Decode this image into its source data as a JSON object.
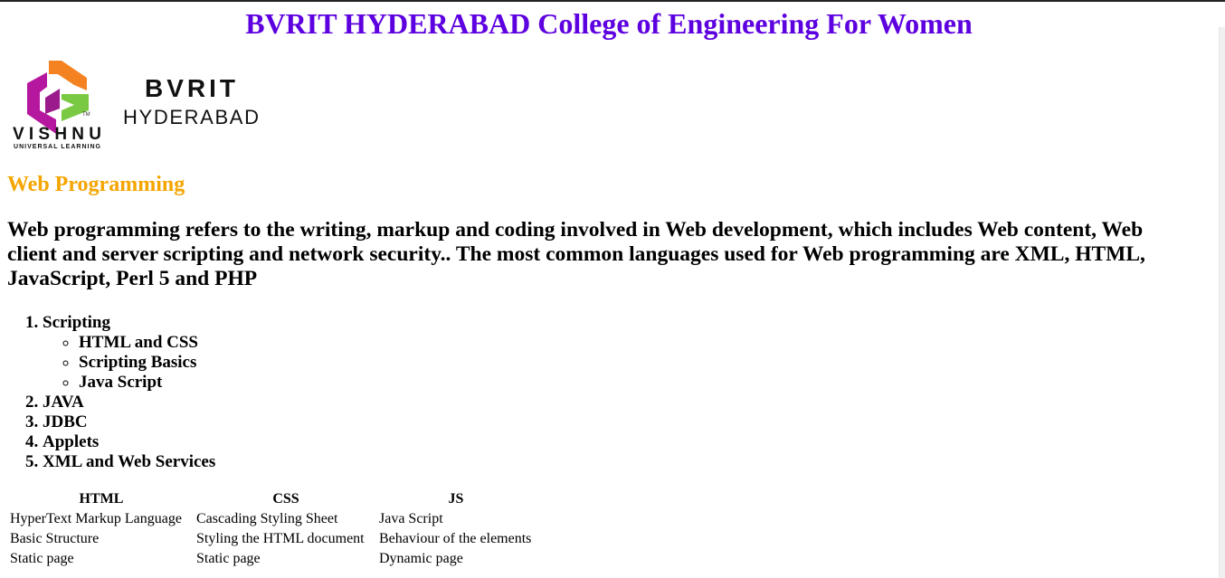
{
  "header": {
    "title": "BVRIT HYDERABAD College of Engineering For Women"
  },
  "logo": {
    "brand_word": "VISHNU",
    "brand_tag": "UNIVERSAL LEARNING",
    "tm": "TM",
    "college_name": "BVRIT",
    "college_city": "HYDERABAD",
    "colors": {
      "orange": "#f58220",
      "magenta": "#b5179e",
      "green": "#7ac943"
    }
  },
  "subject": {
    "title": "Web Programming",
    "color": "#f5a500"
  },
  "description": "Web programming refers to the writing, markup and coding involved in Web development, which includes Web content, Web client and server scripting and network security.. The most common languages used for Web programming are XML, HTML, JavaScript, Perl 5 and PHP",
  "topics": [
    {
      "label": "Scripting",
      "children": [
        "HTML and CSS",
        "Scripting Basics",
        "Java Script"
      ]
    },
    {
      "label": "JAVA"
    },
    {
      "label": "JDBC"
    },
    {
      "label": "Applets"
    },
    {
      "label": "XML and Web Services"
    }
  ],
  "table": {
    "headers": [
      "HTML",
      "CSS",
      "JS"
    ],
    "rows": [
      [
        "HyperText Markup Language",
        "Cascading Styling Sheet",
        "Java Script"
      ],
      [
        "Basic Structure",
        "Styling the HTML document",
        "Behaviour of the elements"
      ],
      [
        "Static page",
        "Static page",
        "Dynamic page"
      ]
    ]
  }
}
